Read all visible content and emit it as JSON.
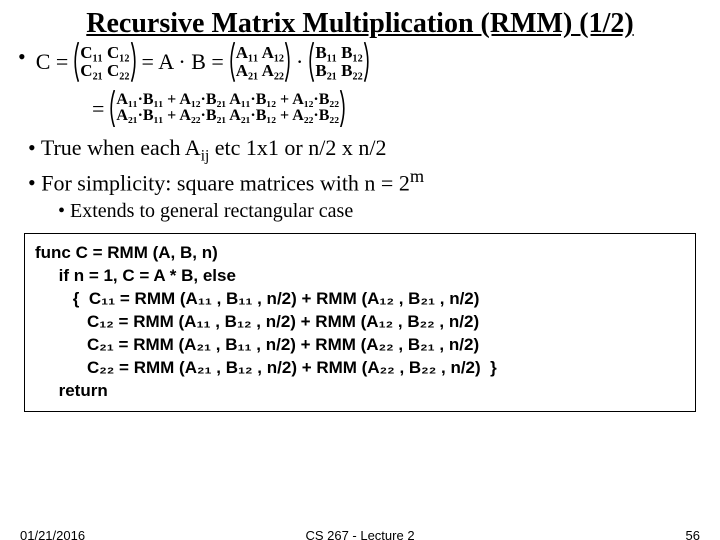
{
  "title": "Recursive Matrix Multiplication (RMM) (1/2)",
  "eq": {
    "lead": "C  =",
    "C": {
      "r1": "C₁₁ C₁₂",
      "r2": "C₂₁ C₂₂"
    },
    "mid1": "=  A · B  =",
    "A": {
      "r1": "A₁₁ A₁₂",
      "r2": "A₂₁ A₂₂"
    },
    "dot": "·",
    "B": {
      "r1": "B₁₁ B₁₂",
      "r2": "B₂₁ B₂₂"
    },
    "eq2": "=",
    "R": {
      "r1": "A₁₁·B₁₁ + A₁₂·B₂₁   A₁₁·B₁₂ + A₁₂·B₂₂",
      "r2": "A₂₁·B₁₁ + A₂₂·B₂₁   A₂₁·B₁₂ + A₂₂·B₂₂"
    }
  },
  "bullet1_a": "True when each A",
  "bullet1_sub": "ij",
  "bullet1_b": " etc   1x1   or   n/2  x  n/2",
  "bullet2_a": "For simplicity: square matrices with n = 2",
  "bullet2_sup": "m",
  "subbullet": "Extends to general rectangular case",
  "code": {
    "l1": "func C = RMM (A, B, n)",
    "l2": "     if n = 1, C = A * B, else",
    "l3": "        {  C₁₁ = RMM (A₁₁ , B₁₁ , n/2) + RMM (A₁₂ , B₂₁ , n/2)",
    "l4": "           C₁₂ = RMM (A₁₁ , B₁₂ , n/2) + RMM (A₁₂ , B₂₂ , n/2)",
    "l5": "           C₂₁ = RMM (A₂₁ , B₁₁ , n/2) + RMM (A₂₂ , B₂₁ , n/2)",
    "l6": "           C₂₂ = RMM (A₂₁ , B₁₂ , n/2) + RMM (A₂₂ , B₂₂ , n/2)  }",
    "l7": "     return"
  },
  "footer": {
    "date": "01/21/2016",
    "course": "CS 267 - Lecture 2",
    "page": "56"
  }
}
